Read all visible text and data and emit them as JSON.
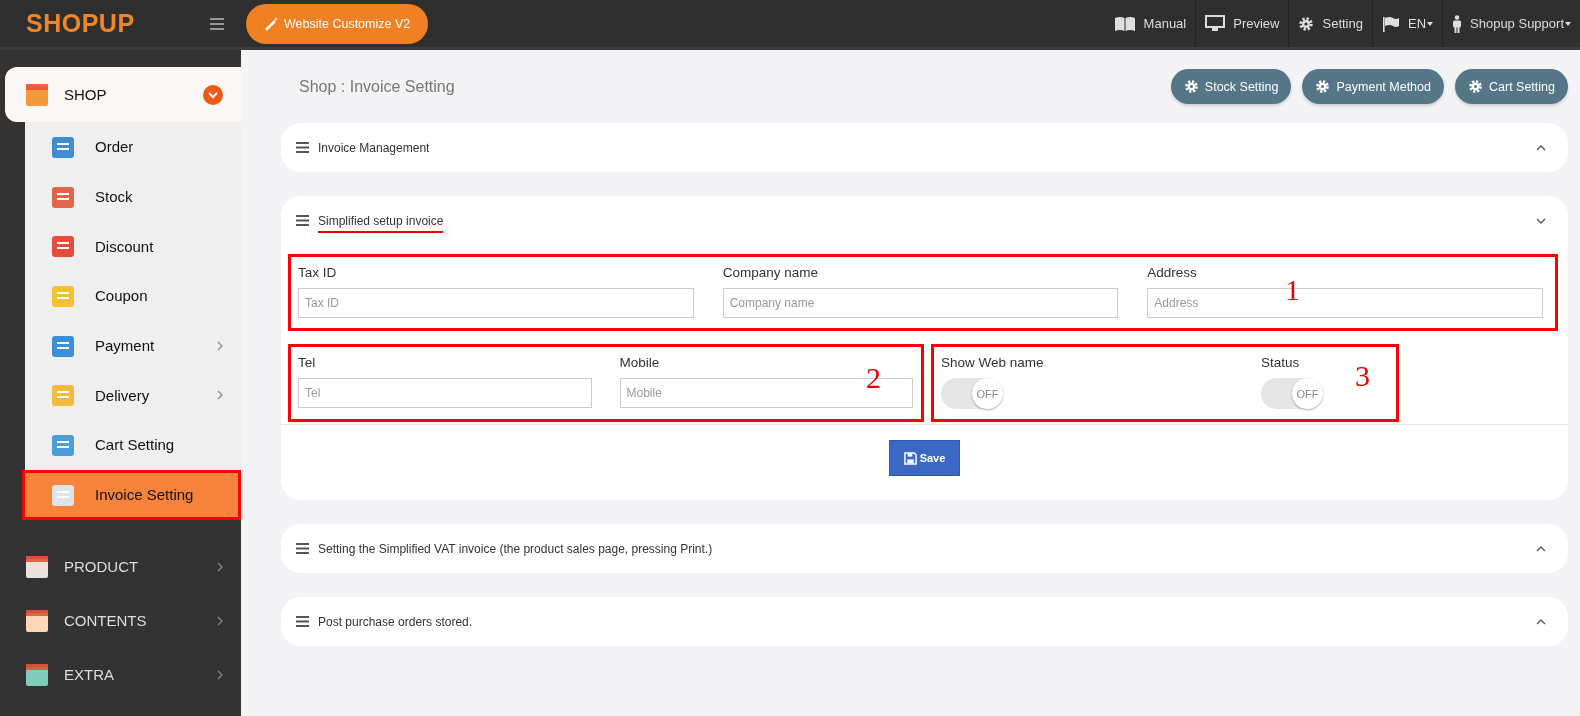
{
  "topbar": {
    "logo": "SHOPUP",
    "customize_button": "Website Customize V2",
    "links": [
      {
        "label": "Manual",
        "dropdown": false
      },
      {
        "label": "Preview",
        "dropdown": false
      },
      {
        "label": "Setting",
        "dropdown": false
      },
      {
        "label": "EN",
        "dropdown": true
      },
      {
        "label": "Shopup Support",
        "dropdown": true
      }
    ]
  },
  "sidebar": {
    "groups": [
      {
        "label": "SHOP",
        "expanded": true,
        "children": [
          {
            "label": "Order",
            "submenu": false,
            "selected": false
          },
          {
            "label": "Stock",
            "submenu": false,
            "selected": false
          },
          {
            "label": "Discount",
            "submenu": false,
            "selected": false
          },
          {
            "label": "Coupon",
            "submenu": false,
            "selected": false
          },
          {
            "label": "Payment",
            "submenu": true,
            "selected": false
          },
          {
            "label": "Delivery",
            "submenu": true,
            "selected": false
          },
          {
            "label": "Cart Setting",
            "submenu": false,
            "selected": false
          },
          {
            "label": "Invoice Setting",
            "submenu": false,
            "selected": true,
            "highlighted": true
          }
        ]
      },
      {
        "label": "PRODUCT",
        "expanded": false
      },
      {
        "label": "CONTENTS",
        "expanded": false
      },
      {
        "label": "EXTRA",
        "expanded": false
      }
    ]
  },
  "page_title": "Shop : Invoice Setting",
  "header_buttons": [
    "Stock Setting",
    "Payment Method",
    "Cart Setting"
  ],
  "panels": [
    {
      "title": "Invoice Management",
      "expanded": false,
      "underlined": false
    },
    {
      "title": "Simplified setup invoice",
      "expanded": true,
      "underlined": true,
      "groups": [
        {
          "annotation": "1",
          "fields": [
            {
              "kind": "input",
              "label": "Tax ID",
              "placeholder": "Tax ID"
            },
            {
              "kind": "input",
              "label": "Company name",
              "placeholder": "Company name"
            },
            {
              "kind": "input",
              "label": "Address",
              "placeholder": "Address"
            }
          ]
        },
        {
          "annotation": "2",
          "fields": [
            {
              "kind": "input",
              "label": "Tel",
              "placeholder": "Tel"
            },
            {
              "kind": "input",
              "label": "Mobile",
              "placeholder": "Mobile"
            }
          ]
        },
        {
          "annotation": "3",
          "fields": [
            {
              "kind": "toggle",
              "label": "Show Web name",
              "on": false,
              "state": "OFF"
            },
            {
              "kind": "toggle",
              "label": "Status",
              "on": false,
              "state": "OFF"
            }
          ]
        }
      ],
      "save_button": "Save"
    },
    {
      "title": "Setting the Simplified VAT invoice (the product sales page, pressing Print.)",
      "expanded": false,
      "underlined": false
    },
    {
      "title": "Post purchase orders stored.",
      "expanded": false,
      "underlined": false
    }
  ]
}
